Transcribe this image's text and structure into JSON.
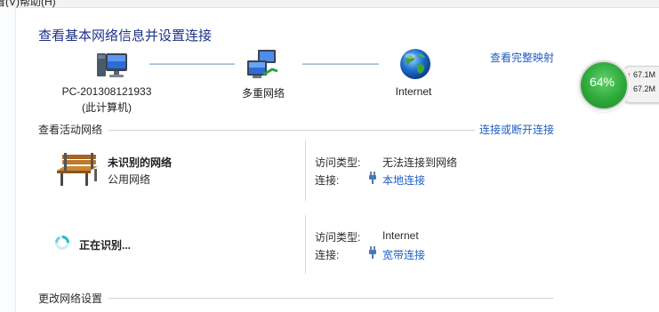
{
  "menu": {
    "item_1": "看(V)",
    "item_2": "帮助(H)"
  },
  "title": "查看基本网络信息并设置连接",
  "map_link": "查看完整映射",
  "computer": {
    "name": "PC-201308121933",
    "subtitle": "(此计算机)"
  },
  "multi_network_label": "多重网络",
  "internet_label": "Internet",
  "active_section": {
    "title": "查看活动网络",
    "connect_link": "连接或断开连接"
  },
  "networks": [
    {
      "name": "未识别的网络",
      "category": "公用网络",
      "access_type_label": "访问类型:",
      "access_type_value": "无法连接到网络",
      "connection_label": "连接:",
      "connection_value": "本地连接"
    },
    {
      "name": "正在识别...",
      "access_type_label": "访问类型:",
      "access_type_value": "Internet",
      "connection_label": "连接:",
      "connection_value": "宽带连接"
    }
  ],
  "change_section_title": "更改网络设置",
  "widget": {
    "percent_text": "64%",
    "percent": 64,
    "upload": "67.1M",
    "download": "67.2M"
  },
  "colors": {
    "title": "#1e3287",
    "link": "#1f5fbf",
    "gauge": "#2ea83a"
  },
  "icons": [
    "computer-icon",
    "multi-network-icon",
    "globe-icon",
    "bench-icon",
    "spinner-icon",
    "plug-icon",
    "up-arrow-icon",
    "down-arrow-icon"
  ]
}
